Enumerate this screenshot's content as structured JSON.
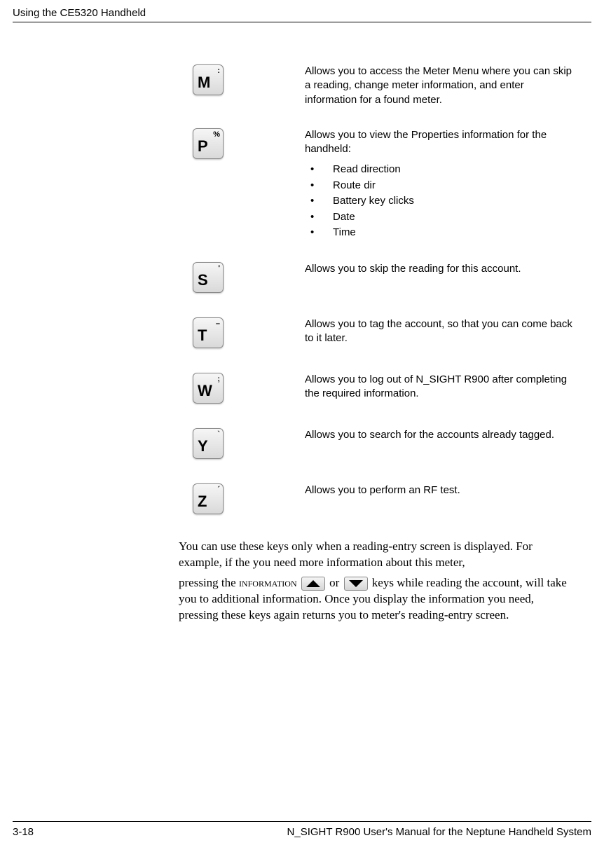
{
  "header": "Using the CE5320 Handheld",
  "keys": [
    {
      "main": "M",
      "sup": ":",
      "desc": "Allows you to access the Meter Menu where you can skip a reading, change meter information, and enter information for a found meter."
    },
    {
      "main": "P",
      "sup": "%",
      "desc": "Allows you to view the Properties information for the handheld:",
      "bullets": [
        "Read direction",
        "Route dir",
        "Battery key clicks",
        "Date",
        "Time"
      ]
    },
    {
      "main": "S",
      "sup": "'",
      "desc": "Allows you to skip the reading for this account."
    },
    {
      "main": "T",
      "sup": "–",
      "desc": "Allows you to tag the account, so that you can come back to it later."
    },
    {
      "main": "W",
      "sup": ";",
      "desc": "Allows you to log out of N_SIGHT R900 after completing the required information."
    },
    {
      "main": "Y",
      "sup": "`",
      "desc": "Allows you to search for the accounts already tagged."
    },
    {
      "main": "Z",
      "sup": "´",
      "desc": "Allows you to perform an RF test."
    }
  ],
  "body": {
    "p1": "You can use these keys only when a reading-entry screen is displayed. For example, if the you need more information about this meter,",
    "p2a": "pressing the ",
    "p2b": " or ",
    "p2c": "keys while reading the account, will take you to additional information. Once you display the information you need, pressing these keys again returns you to meter's reading-entry screen.",
    "info_word": "information"
  },
  "footer": {
    "left": "3-18",
    "right": "N_SIGHT R900 User's Manual for the Neptune Handheld System"
  }
}
